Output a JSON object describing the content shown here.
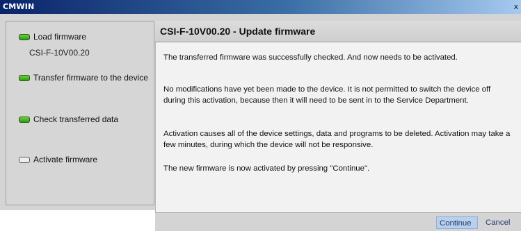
{
  "window": {
    "title": "CMWIN",
    "close_glyph": "x"
  },
  "sidebar": {
    "steps": [
      {
        "label": "Load firmware",
        "status": "done",
        "sublabel": "CSI-F-10V00.20"
      },
      {
        "label": "Transfer firmware to the device",
        "status": "done"
      },
      {
        "label": "Check transferred data",
        "status": "done"
      },
      {
        "label": "Activate firmware",
        "status": "pending"
      }
    ],
    "status_colors": {
      "done": "#3fae22",
      "pending": "#eeeeee"
    }
  },
  "panel": {
    "title": "CSI-F-10V00.20 - Update firmware",
    "paragraphs": [
      "The transferred firmware was successfully checked. And now needs to be activated.",
      "No modifications have yet been made to the device. It is not permitted to switch the device off during this activation, because then it will need to be sent in to the Service Department.",
      "Activation causes all of the device settings, data and programs to be deleted. Activation may take a few minutes, during which the device will not be responsive.",
      "The new firmware is now activated by pressing \"Continue\"."
    ]
  },
  "buttons": {
    "continue_label": "Continue",
    "cancel_label": "Cancel"
  }
}
